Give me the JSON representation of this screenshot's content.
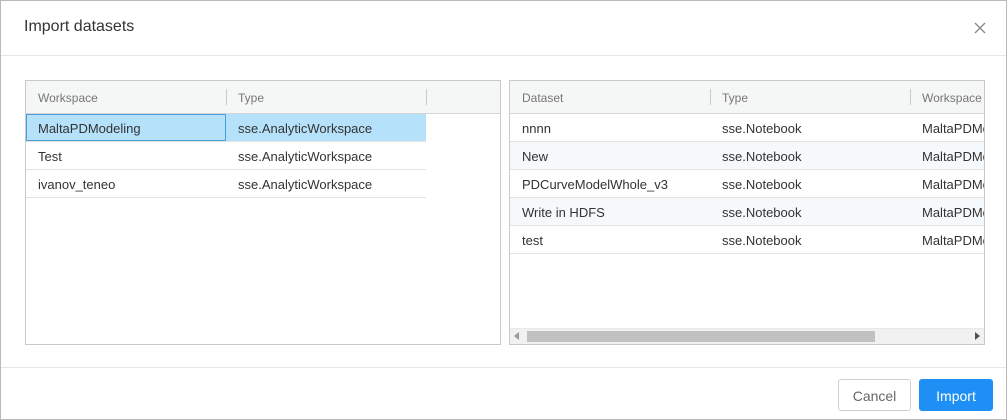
{
  "dialog": {
    "title": "Import datasets",
    "close_icon": "close-icon"
  },
  "workspaces": {
    "columns": [
      "Workspace",
      "Type"
    ],
    "rows": [
      {
        "workspace": "MaltaPDModeling",
        "type": "sse.AnalyticWorkspace",
        "selected": true
      },
      {
        "workspace": "Test",
        "type": "sse.AnalyticWorkspace",
        "selected": false
      },
      {
        "workspace": "ivanov_teneo",
        "type": "sse.AnalyticWorkspace",
        "selected": false
      }
    ]
  },
  "datasets": {
    "columns": [
      "Dataset",
      "Type",
      "Workspace"
    ],
    "rows": [
      {
        "dataset": "nnnn",
        "type": "sse.Notebook",
        "workspace": "MaltaPDModeling"
      },
      {
        "dataset": "New",
        "type": "sse.Notebook",
        "workspace": "MaltaPDModeling"
      },
      {
        "dataset": "PDCurveModelWhole_v3",
        "type": "sse.Notebook",
        "workspace": "MaltaPDModeling"
      },
      {
        "dataset": "Write in HDFS",
        "type": "sse.Notebook",
        "workspace": "MaltaPDModeling"
      },
      {
        "dataset": "test",
        "type": "sse.Notebook",
        "workspace": "MaltaPDModeling"
      }
    ]
  },
  "footer": {
    "cancel_label": "Cancel",
    "import_label": "Import"
  },
  "colors": {
    "primary": "#1e90f5",
    "selection": "#b5e1fb",
    "header_bg": "#f5f6f6"
  }
}
